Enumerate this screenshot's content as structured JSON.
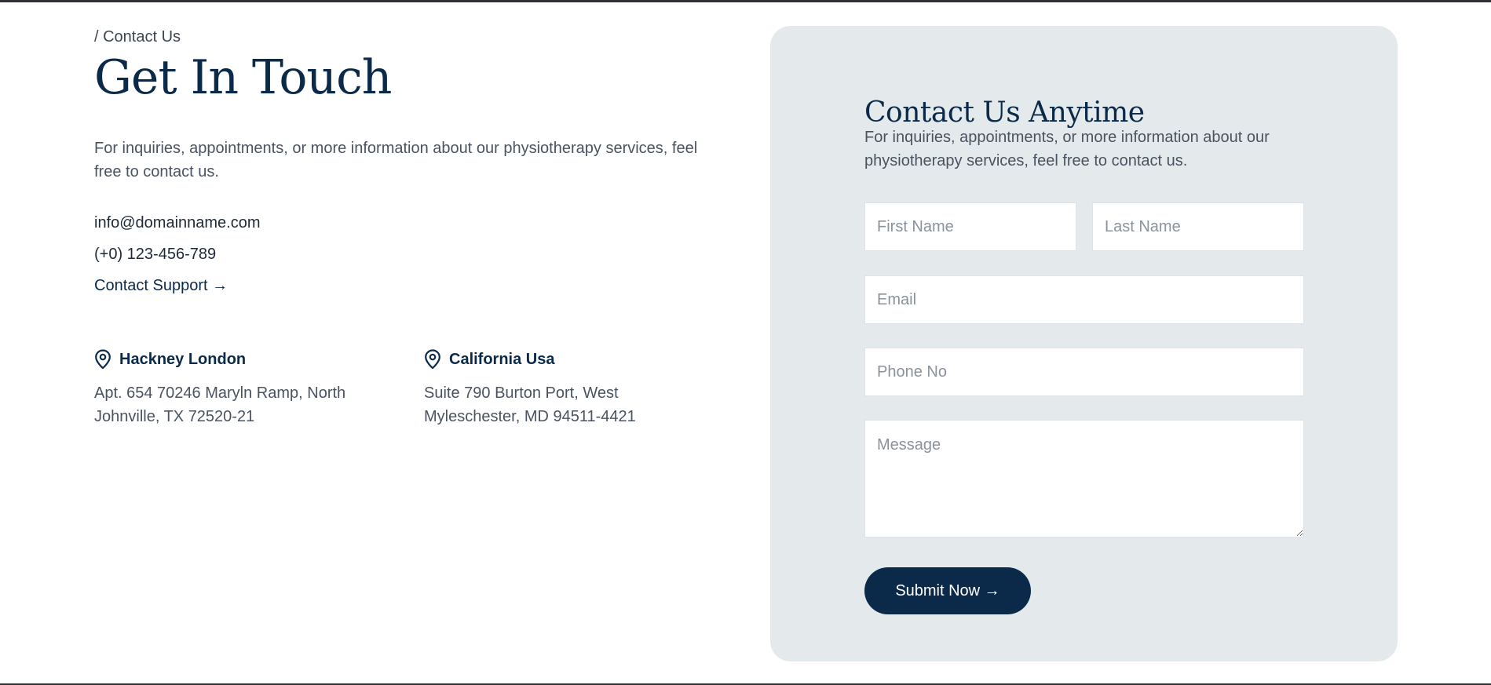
{
  "breadcrumb": "/ Contact Us",
  "page_title": "Get In Touch",
  "intro": "For inquiries, appointments, or more information about our physiotherapy services, feel free to contact us.",
  "contact": {
    "email": "info@domainname.com",
    "phone": "(+0) 123-456-789",
    "support_link": "Contact Support →"
  },
  "locations": [
    {
      "name": "Hackney London",
      "icon": "map-pin-icon",
      "address": "Apt. 654 70246 Maryln Ramp, North Johnville, TX 72520-21"
    },
    {
      "name": "California Usa",
      "icon": "map-pin-icon",
      "address": "Suite 790 Burton Port, West Myleschester, MD 94511-4421"
    }
  ],
  "form": {
    "title": "Contact Us Anytime",
    "intro": "For inquiries, appointments, or more information about our physiotherapy services, feel free to contact us.",
    "first_name": {
      "placeholder": "First Name",
      "value": ""
    },
    "last_name": {
      "placeholder": "Last Name",
      "value": ""
    },
    "email": {
      "placeholder": "Email",
      "value": ""
    },
    "phone": {
      "placeholder": "Phone No",
      "value": ""
    },
    "message": {
      "placeholder": "Message",
      "value": ""
    },
    "submit_label": "Submit Now →"
  },
  "colors": {
    "primary": "#0b2a4a",
    "card_bg": "#e4e9ec",
    "text": "#4a5361"
  }
}
